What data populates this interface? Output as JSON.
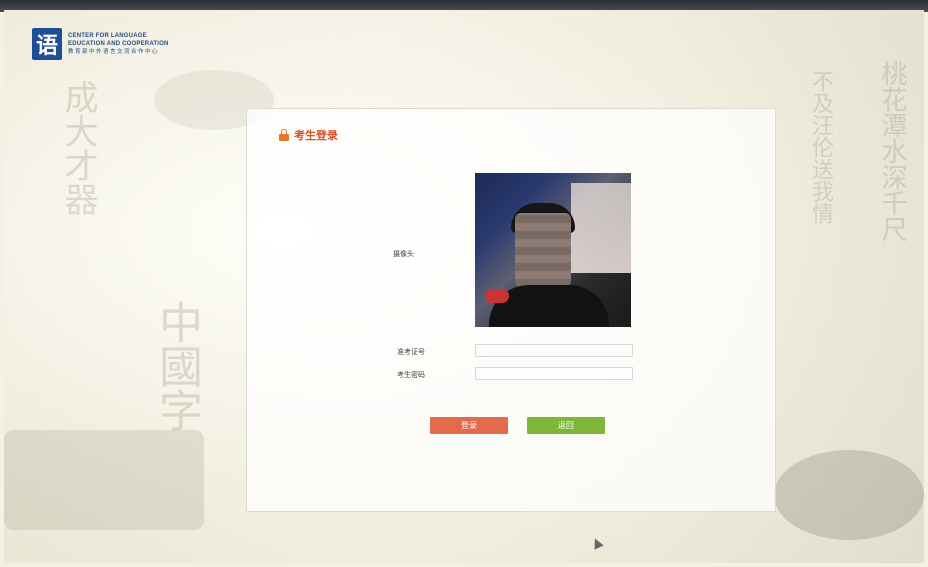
{
  "logo": {
    "mark": "语",
    "line1": "CENTER FOR LANGUAGE",
    "line2": "EDUCATION AND COOPERATION",
    "line3": "教育部中外语言交流合作中心"
  },
  "panel": {
    "title": "考生登录",
    "camera_label": "摄像头",
    "ticket_label": "准考证号",
    "password_label": "考生密码",
    "ticket_value": "",
    "password_value": "",
    "login_button": "登录",
    "back_button": "返回"
  },
  "colors": {
    "accent_title": "#d6502a",
    "login": "#e46a4c",
    "back": "#7cb73a"
  }
}
